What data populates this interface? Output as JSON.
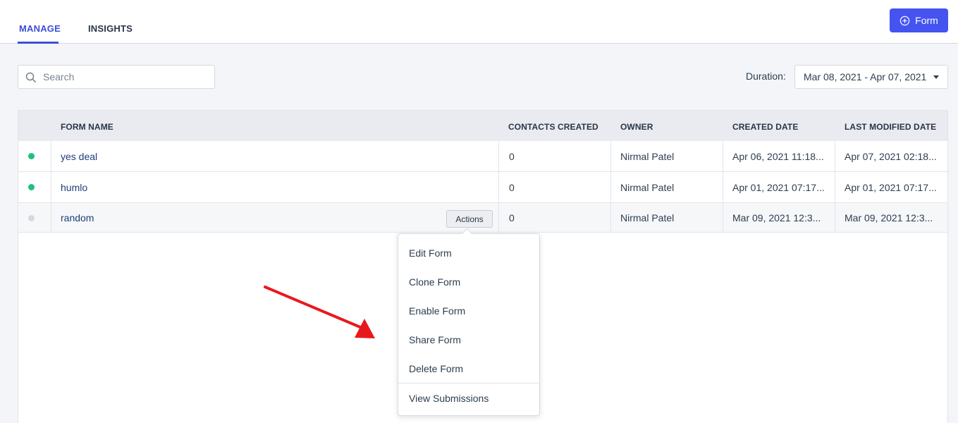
{
  "tabs": [
    {
      "label": "MANAGE",
      "active": true
    },
    {
      "label": "INSIGHTS",
      "active": false
    }
  ],
  "new_form_button": {
    "label": "Form",
    "icon": "plus-circle-icon"
  },
  "search": {
    "placeholder": "Search",
    "value": "",
    "icon": "search-icon"
  },
  "duration": {
    "label": "Duration:",
    "value": "Mar 08, 2021 - Apr 07, 2021"
  },
  "table": {
    "columns": [
      "FORM NAME",
      "CONTACTS CREATED",
      "OWNER",
      "CREATED DATE",
      "LAST MODIFIED DATE"
    ],
    "rows": [
      {
        "status": "active",
        "status_color": "#1ec27a",
        "name": "yes deal",
        "contacts": "0",
        "owner": "Nirmal Patel",
        "created": "Apr 06, 2021 11:18...",
        "modified": "Apr 07, 2021 02:18..."
      },
      {
        "status": "active",
        "status_color": "#1ec27a",
        "name": "humlo",
        "contacts": "0",
        "owner": "Nirmal Patel",
        "created": "Apr 01, 2021 07:17...",
        "modified": "Apr 01, 2021 07:17..."
      },
      {
        "status": "disabled",
        "status_color": "#d3d8e2",
        "name": "random",
        "contacts": "0",
        "owner": "Nirmal Patel",
        "created": "Mar 09, 2021 12:3...",
        "modified": "Mar 09, 2021 12:3...",
        "actions_label": "Actions"
      }
    ]
  },
  "actions_menu": {
    "items": [
      "Edit Form",
      "Clone Form",
      "Enable Form",
      "Share Form",
      "Delete Form"
    ],
    "footer_item": "View Submissions"
  },
  "colors": {
    "accent": "#3f4fd8",
    "button": "#4553f0",
    "annotation_arrow": "#e8191b"
  }
}
